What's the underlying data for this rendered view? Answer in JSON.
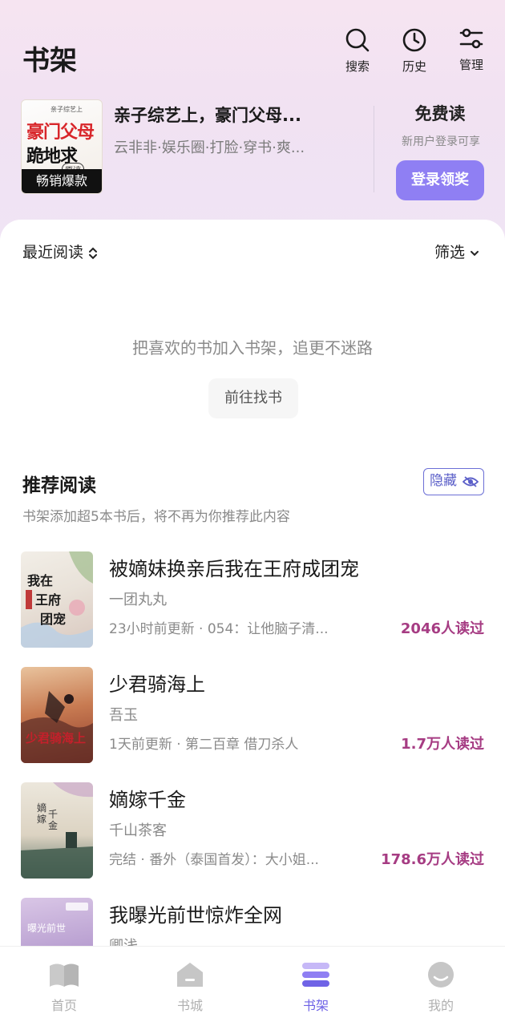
{
  "header": {
    "title": "书架",
    "actions": [
      {
        "label": "搜索",
        "icon": "search-icon"
      },
      {
        "label": "历史",
        "icon": "clock-icon"
      },
      {
        "label": "管理",
        "icon": "sliders-icon"
      }
    ]
  },
  "promo": {
    "cover_text_small": "亲子综艺上",
    "cover_text_1": "豪门父母",
    "cover_text_2": "跪地求",
    "cover_text_3": "原谅",
    "cover_tag": "畅销爆款",
    "title": "亲子综艺上，豪门父母...",
    "subtitle": "云非非·娱乐圈·打脸·穿书·爽...",
    "free_title": "免费读",
    "free_subtitle": "新用户登录可享",
    "login_button": "登录领奖"
  },
  "shelf": {
    "sort_label": "最近阅读",
    "filter_label": "筛选",
    "empty_text": "把喜欢的书加入书架，追更不迷路",
    "goto_button": "前往找书"
  },
  "recommend": {
    "title": "推荐阅读",
    "hide_button": "隐藏",
    "note": "书架添加超5本书后，将不再为你推荐此内容",
    "books": [
      {
        "title": "被嫡妹换亲后我在王府成团宠",
        "author": "一团丸丸",
        "update": "23小时前更新 · 054：让他脑子清...",
        "readers": "2046人读过"
      },
      {
        "title": "少君骑海上",
        "author": "吾玉",
        "update": "1天前更新 · 第二百章 借刀杀人",
        "readers": "1.7万人读过"
      },
      {
        "title": "嫡嫁千金",
        "author": "千山茶客",
        "update": "完结 · 番外（泰国首发）：大小姐...",
        "readers": "178.6万人读过"
      },
      {
        "title": "我曝光前世惊炸全网",
        "author": "卿浅",
        "update": "",
        "readers": ""
      }
    ]
  },
  "tabbar": {
    "tabs": [
      {
        "label": "首页",
        "icon": "book-open-icon",
        "active": false
      },
      {
        "label": "书城",
        "icon": "store-icon",
        "active": false
      },
      {
        "label": "书架",
        "icon": "shelf-icon",
        "active": true
      },
      {
        "label": "我的",
        "icon": "profile-icon",
        "active": false
      }
    ]
  },
  "colors": {
    "accent": "#8f7ff3",
    "readers": "#a63c83",
    "tab_active": "#6f63e6"
  }
}
